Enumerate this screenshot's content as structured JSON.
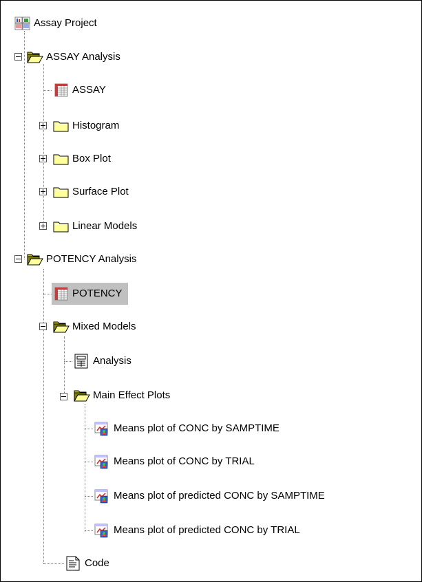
{
  "tree": {
    "root": {
      "label": "Assay Project",
      "icon": "project-icon"
    },
    "assay_analysis": {
      "label": "ASSAY Analysis",
      "icon": "open-folder-icon",
      "expanded": true,
      "children": [
        {
          "label": "ASSAY",
          "icon": "dataset-icon"
        },
        {
          "label": "Histogram",
          "icon": "closed-folder-icon",
          "expanded": false
        },
        {
          "label": "Box Plot",
          "icon": "closed-folder-icon",
          "expanded": false
        },
        {
          "label": "Surface Plot",
          "icon": "closed-folder-icon",
          "expanded": false
        },
        {
          "label": "Linear Models",
          "icon": "closed-folder-icon",
          "expanded": false
        }
      ]
    },
    "potency_analysis": {
      "label": "POTENCY Analysis",
      "icon": "open-folder-icon",
      "expanded": true,
      "dataset": {
        "label": "POTENCY",
        "icon": "dataset-icon",
        "selected": true
      },
      "mixed_models": {
        "label": "Mixed Models",
        "icon": "open-folder-icon",
        "expanded": true,
        "analysis": {
          "label": "Analysis",
          "icon": "analysis-icon"
        },
        "main_effect_plots": {
          "label": "Main Effect Plots",
          "icon": "open-folder-icon",
          "expanded": true,
          "children": [
            {
              "label": "Means plot of CONC by SAMPTIME",
              "icon": "graph-icon"
            },
            {
              "label": "Means plot of CONC by TRIAL",
              "icon": "graph-icon"
            },
            {
              "label": "Means plot of predicted CONC by SAMPTIME",
              "icon": "graph-icon"
            },
            {
              "label": "Means plot of predicted CONC by TRIAL",
              "icon": "graph-icon"
            }
          ]
        },
        "code": {
          "label": "Code",
          "icon": "code-icon"
        }
      }
    }
  },
  "colors": {
    "selection": "#c0c0c0",
    "folder": "#ffff99",
    "tree_lines": "#808080"
  }
}
